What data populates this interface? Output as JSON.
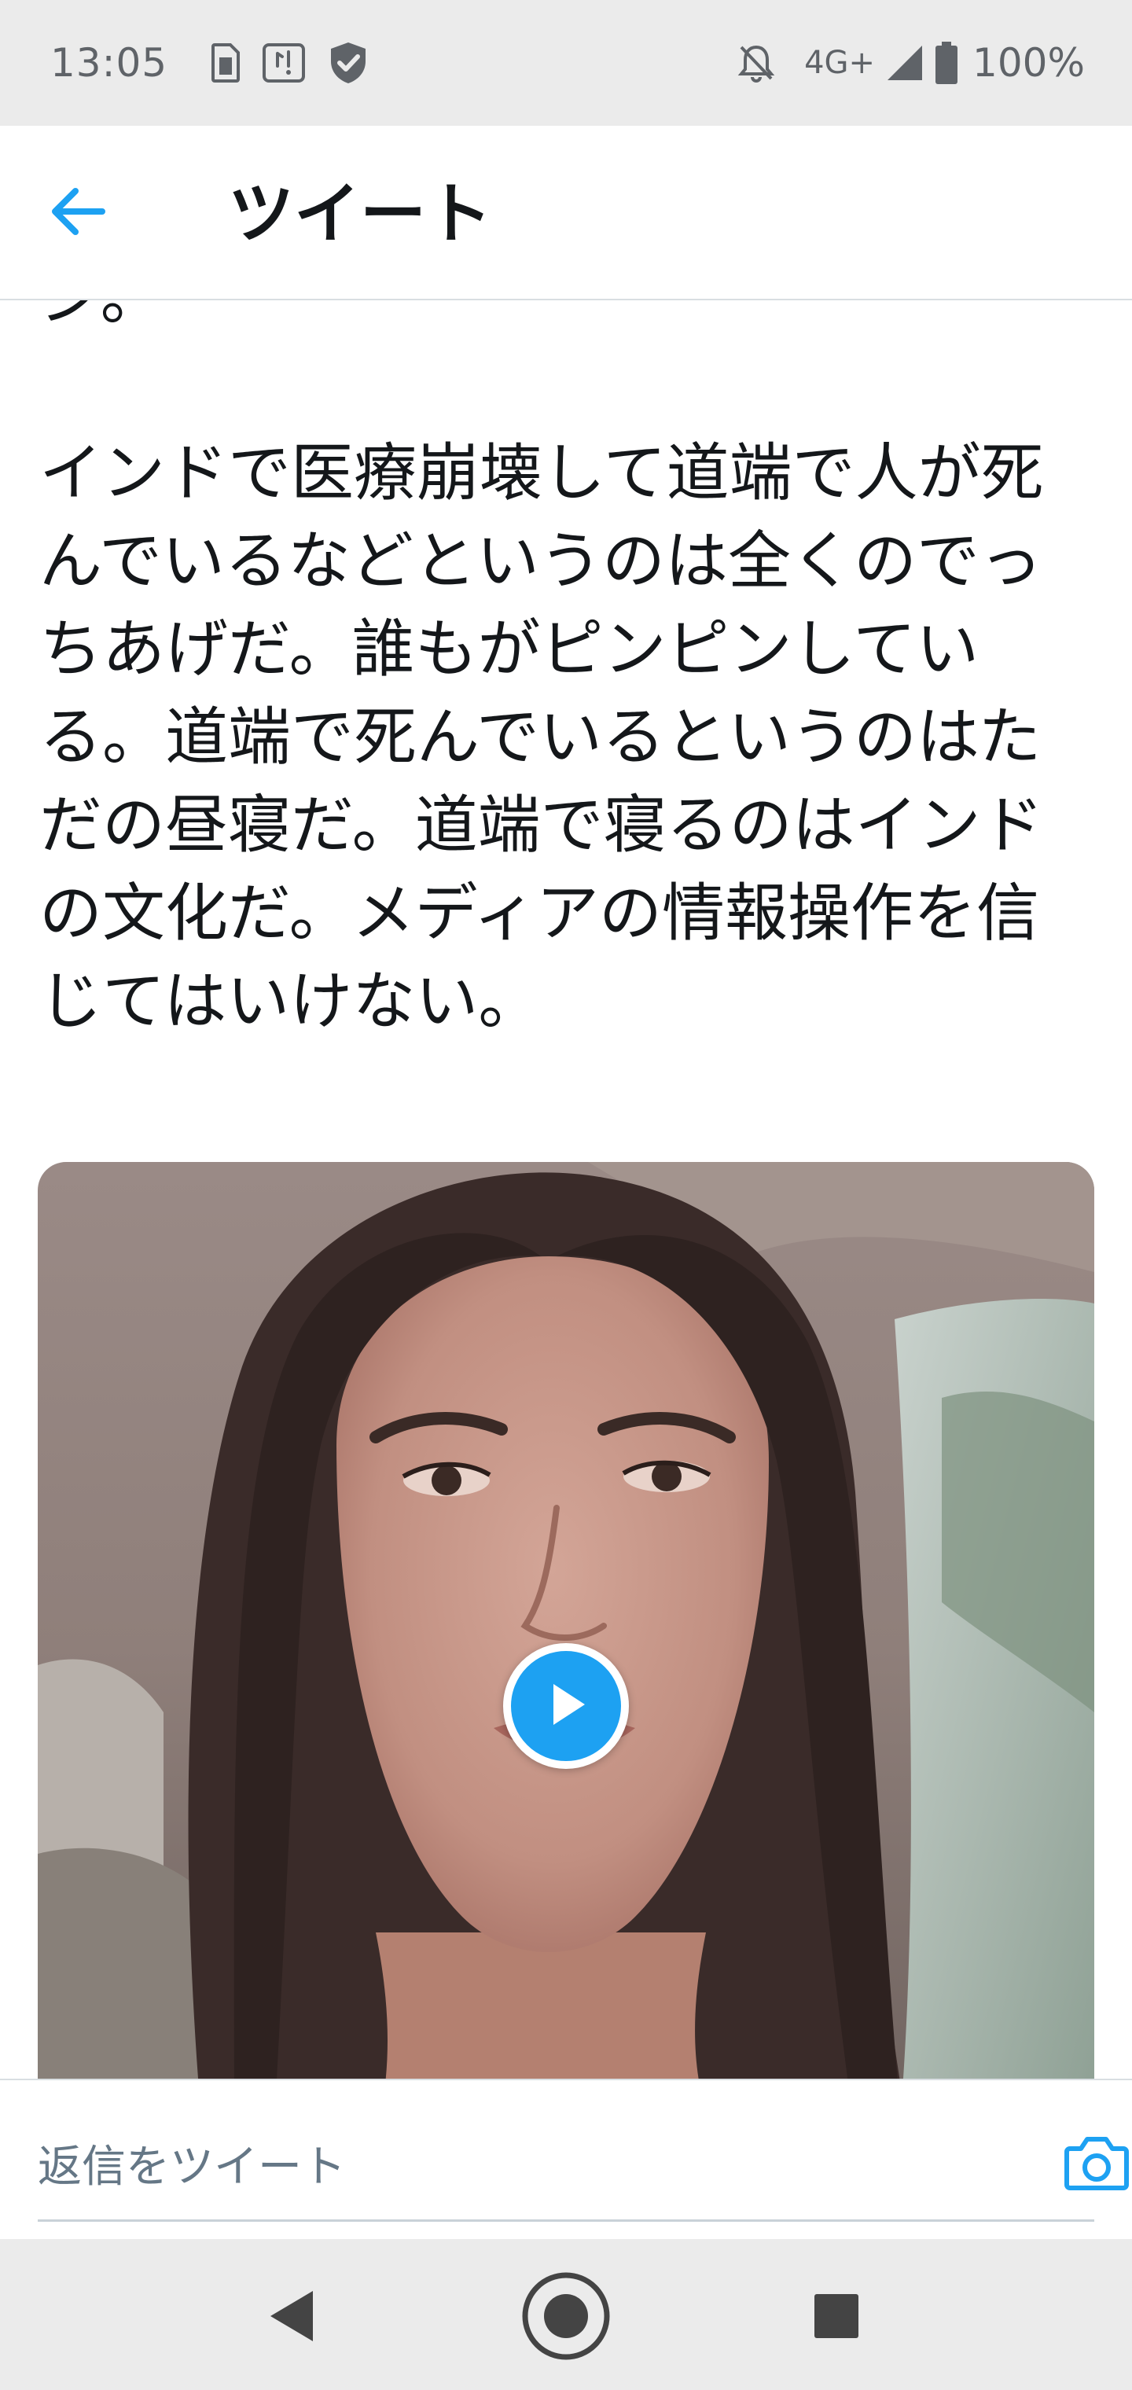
{
  "status_bar": {
    "time": "13:05",
    "network": "4G+",
    "battery_percent": "100%",
    "left_icons": [
      "sim-card-icon",
      "app-notification-icon",
      "shield-check-icon"
    ],
    "right_icons": [
      "notifications-off-icon",
      "signal-icon",
      "battery-icon"
    ]
  },
  "header": {
    "back_icon": "arrow-left-icon",
    "title": "ツイート",
    "accent_color": "#1da1f2"
  },
  "tweet": {
    "text": "ジ。\n\nインドで医療崩壊して道端で人が死んでいるなどというのは全くのでっちあげだ。誰もがピンピンしている。道端で死んでいるというのはただの昼寝だ。道端で寝るのはインドの文化だ。メディアの情報操作を信じてはいけない。",
    "media": {
      "type": "video",
      "play_icon": "play-icon"
    }
  },
  "reply": {
    "placeholder": "返信をツイート",
    "camera_icon": "camera-icon"
  },
  "nav_bar": {
    "back_icon": "nav-back-icon",
    "home_icon": "nav-home-icon",
    "recents_icon": "nav-recents-icon"
  }
}
